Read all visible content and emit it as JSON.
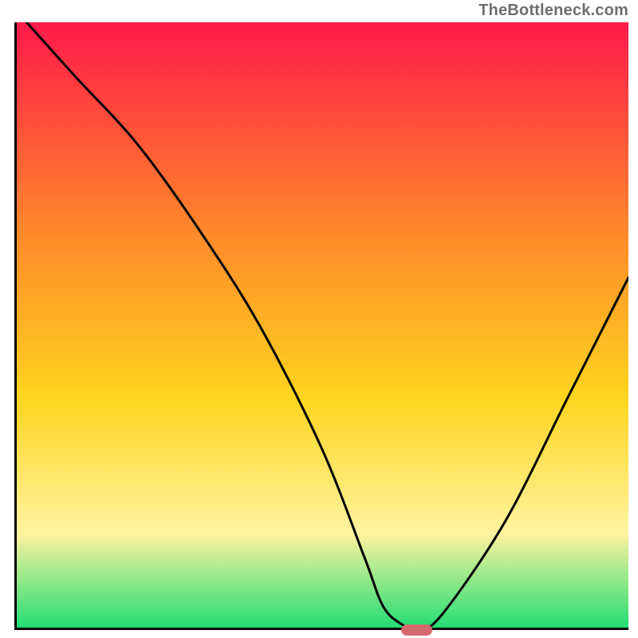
{
  "attribution": "TheBottleneck.com",
  "colors": {
    "gradient_top": "#ff1a4b",
    "gradient_mid1": "#ff8a2a",
    "gradient_mid2": "#ffd51f",
    "gradient_mid3": "#fff3a0",
    "gradient_bottom": "#1fdc73",
    "curve": "#000000",
    "axis": "#000000",
    "marker": "#d46a6f"
  },
  "chart_data": {
    "type": "line",
    "title": "",
    "xlabel": "",
    "ylabel": "",
    "xlim": [
      0,
      100
    ],
    "ylim": [
      0,
      100
    ],
    "x": [
      2,
      10,
      20,
      30,
      40,
      50,
      57,
      60,
      63,
      66,
      70,
      80,
      90,
      100
    ],
    "values": [
      100,
      91,
      80,
      66,
      50,
      30,
      12,
      4,
      1,
      0,
      3,
      18,
      38,
      58
    ],
    "minimum_marker": {
      "x_start": 63,
      "x_end": 68,
      "y": 0
    },
    "annotations": []
  }
}
